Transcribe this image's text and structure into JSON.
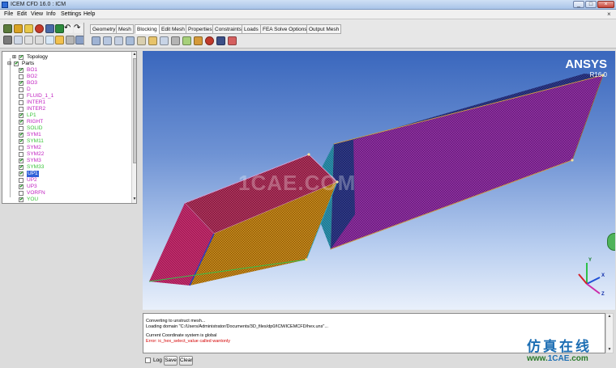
{
  "window": {
    "title": "ICEM CFD 16.0 : ICM",
    "min_glyph": "_",
    "max_glyph": "□",
    "close_glyph": "×"
  },
  "menu": [
    "File",
    "Edit",
    "View",
    "Info",
    "Settings",
    "Help"
  ],
  "tabs": [
    "Geometry",
    "Mesh",
    "Blocking",
    "Edit Mesh",
    "Properties",
    "Constraints",
    "Loads",
    "FEA Solve Options",
    "Output Mesh"
  ],
  "active_tab": "Blocking",
  "tree": {
    "topology_label": "Topology",
    "parts_label": "Parts",
    "parts": [
      {
        "name": "BO1",
        "color": "#c01fc0",
        "checked": true
      },
      {
        "name": "BO2",
        "color": "#c01fc0",
        "checked": false
      },
      {
        "name": "BO3",
        "color": "#c01fc0",
        "checked": true
      },
      {
        "name": "D",
        "color": "#c01fc0",
        "checked": false
      },
      {
        "name": "FLUID_1_1",
        "color": "#c01fc0",
        "checked": false
      },
      {
        "name": "INTER1",
        "color": "#c01fc0",
        "checked": false
      },
      {
        "name": "INTER2",
        "color": "#c01fc0",
        "checked": false
      },
      {
        "name": "LP1",
        "color": "#39c439",
        "checked": true
      },
      {
        "name": "RIGHT",
        "color": "#c01fc0",
        "checked": true
      },
      {
        "name": "SOLID",
        "color": "#39c439",
        "checked": false
      },
      {
        "name": "SYM1",
        "color": "#c01fc0",
        "checked": true
      },
      {
        "name": "SYM11",
        "color": "#39c439",
        "checked": true
      },
      {
        "name": "SYM2",
        "color": "#c01fc0",
        "checked": false
      },
      {
        "name": "SYM22",
        "color": "#c01fc0",
        "checked": false
      },
      {
        "name": "SYM3",
        "color": "#c01fc0",
        "checked": true
      },
      {
        "name": "SYM33",
        "color": "#39c439",
        "checked": true
      },
      {
        "name": "UP1",
        "color": "#ffffff",
        "checked": true,
        "selected": true
      },
      {
        "name": "UP2",
        "color": "#c01fc0",
        "checked": false
      },
      {
        "name": "UP3",
        "color": "#c01fc0",
        "checked": true
      },
      {
        "name": "VORFN",
        "color": "#c01fc0",
        "checked": false
      },
      {
        "name": "YOU",
        "color": "#39c439",
        "checked": true
      }
    ]
  },
  "viewport": {
    "brand": "ANSYS",
    "version": "R16.0",
    "watermark": "1CAE.COM",
    "axis_x": "X",
    "axis_y": "Y",
    "axis_z": "Z"
  },
  "log": {
    "lines": [
      {
        "text": "Converting to unstruct mesh...",
        "type": "normal"
      },
      {
        "text": "Loading domain \"C:/Users/Administrator/Documents/3D_files/dp0/ICM/ICEMCFD/hex.uns\"...",
        "type": "normal"
      },
      {
        "text": "",
        "type": "gap"
      },
      {
        "text": "Current Coordinate system is global",
        "type": "normal"
      },
      {
        "text": "Error: ic_hex_select_value called wantonly",
        "type": "error"
      }
    ],
    "log_label": "Log",
    "save_label": "Save",
    "clear_label": "Clear"
  },
  "brand": {
    "chinese": "仿真在线",
    "web_prefix": "www.",
    "web_domain": "1CAE",
    "web_suffix": ".com"
  },
  "colors": {
    "accent": "#2e6bd6",
    "selected": "#3060d8",
    "error": "#d40000"
  }
}
